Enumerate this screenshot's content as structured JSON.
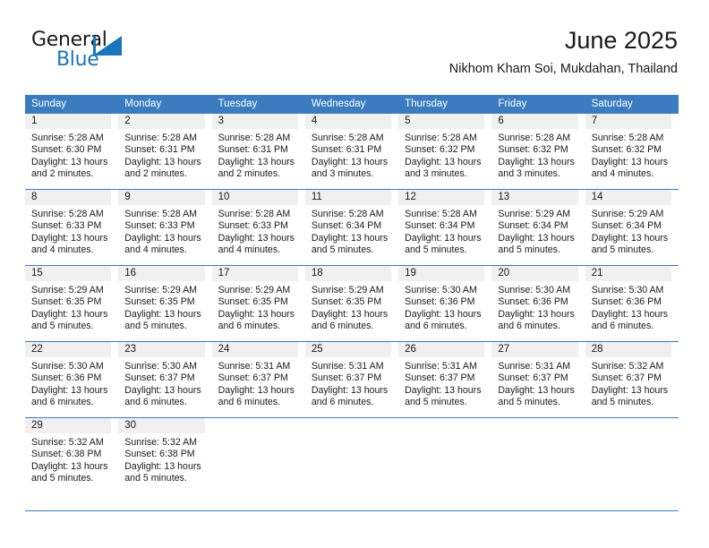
{
  "brand": {
    "name_part1": "General",
    "name_part2": "Blue",
    "accent_color": "#1b75bb"
  },
  "header": {
    "title": "June 2025",
    "subtitle": "Nikhom Kham Soi, Mukdahan, Thailand"
  },
  "theme": {
    "header_row_color": "#3b7cc0",
    "daynum_band_color": "#f0f0f0",
    "text_color": "#1a1a1a"
  },
  "calendar": {
    "weekday_headers": [
      "Sunday",
      "Monday",
      "Tuesday",
      "Wednesday",
      "Thursday",
      "Friday",
      "Saturday"
    ],
    "weeks": [
      [
        {
          "day": "1",
          "sunrise": "Sunrise: 5:28 AM",
          "sunset": "Sunset: 6:30 PM",
          "daylight_line1": "Daylight: 13 hours",
          "daylight_line2": "and 2 minutes."
        },
        {
          "day": "2",
          "sunrise": "Sunrise: 5:28 AM",
          "sunset": "Sunset: 6:31 PM",
          "daylight_line1": "Daylight: 13 hours",
          "daylight_line2": "and 2 minutes."
        },
        {
          "day": "3",
          "sunrise": "Sunrise: 5:28 AM",
          "sunset": "Sunset: 6:31 PM",
          "daylight_line1": "Daylight: 13 hours",
          "daylight_line2": "and 2 minutes."
        },
        {
          "day": "4",
          "sunrise": "Sunrise: 5:28 AM",
          "sunset": "Sunset: 6:31 PM",
          "daylight_line1": "Daylight: 13 hours",
          "daylight_line2": "and 3 minutes."
        },
        {
          "day": "5",
          "sunrise": "Sunrise: 5:28 AM",
          "sunset": "Sunset: 6:32 PM",
          "daylight_line1": "Daylight: 13 hours",
          "daylight_line2": "and 3 minutes."
        },
        {
          "day": "6",
          "sunrise": "Sunrise: 5:28 AM",
          "sunset": "Sunset: 6:32 PM",
          "daylight_line1": "Daylight: 13 hours",
          "daylight_line2": "and 3 minutes."
        },
        {
          "day": "7",
          "sunrise": "Sunrise: 5:28 AM",
          "sunset": "Sunset: 6:32 PM",
          "daylight_line1": "Daylight: 13 hours",
          "daylight_line2": "and 4 minutes."
        }
      ],
      [
        {
          "day": "8",
          "sunrise": "Sunrise: 5:28 AM",
          "sunset": "Sunset: 6:33 PM",
          "daylight_line1": "Daylight: 13 hours",
          "daylight_line2": "and 4 minutes."
        },
        {
          "day": "9",
          "sunrise": "Sunrise: 5:28 AM",
          "sunset": "Sunset: 6:33 PM",
          "daylight_line1": "Daylight: 13 hours",
          "daylight_line2": "and 4 minutes."
        },
        {
          "day": "10",
          "sunrise": "Sunrise: 5:28 AM",
          "sunset": "Sunset: 6:33 PM",
          "daylight_line1": "Daylight: 13 hours",
          "daylight_line2": "and 4 minutes."
        },
        {
          "day": "11",
          "sunrise": "Sunrise: 5:28 AM",
          "sunset": "Sunset: 6:34 PM",
          "daylight_line1": "Daylight: 13 hours",
          "daylight_line2": "and 5 minutes."
        },
        {
          "day": "12",
          "sunrise": "Sunrise: 5:28 AM",
          "sunset": "Sunset: 6:34 PM",
          "daylight_line1": "Daylight: 13 hours",
          "daylight_line2": "and 5 minutes."
        },
        {
          "day": "13",
          "sunrise": "Sunrise: 5:29 AM",
          "sunset": "Sunset: 6:34 PM",
          "daylight_line1": "Daylight: 13 hours",
          "daylight_line2": "and 5 minutes."
        },
        {
          "day": "14",
          "sunrise": "Sunrise: 5:29 AM",
          "sunset": "Sunset: 6:34 PM",
          "daylight_line1": "Daylight: 13 hours",
          "daylight_line2": "and 5 minutes."
        }
      ],
      [
        {
          "day": "15",
          "sunrise": "Sunrise: 5:29 AM",
          "sunset": "Sunset: 6:35 PM",
          "daylight_line1": "Daylight: 13 hours",
          "daylight_line2": "and 5 minutes."
        },
        {
          "day": "16",
          "sunrise": "Sunrise: 5:29 AM",
          "sunset": "Sunset: 6:35 PM",
          "daylight_line1": "Daylight: 13 hours",
          "daylight_line2": "and 5 minutes."
        },
        {
          "day": "17",
          "sunrise": "Sunrise: 5:29 AM",
          "sunset": "Sunset: 6:35 PM",
          "daylight_line1": "Daylight: 13 hours",
          "daylight_line2": "and 6 minutes."
        },
        {
          "day": "18",
          "sunrise": "Sunrise: 5:29 AM",
          "sunset": "Sunset: 6:35 PM",
          "daylight_line1": "Daylight: 13 hours",
          "daylight_line2": "and 6 minutes."
        },
        {
          "day": "19",
          "sunrise": "Sunrise: 5:30 AM",
          "sunset": "Sunset: 6:36 PM",
          "daylight_line1": "Daylight: 13 hours",
          "daylight_line2": "and 6 minutes."
        },
        {
          "day": "20",
          "sunrise": "Sunrise: 5:30 AM",
          "sunset": "Sunset: 6:36 PM",
          "daylight_line1": "Daylight: 13 hours",
          "daylight_line2": "and 6 minutes."
        },
        {
          "day": "21",
          "sunrise": "Sunrise: 5:30 AM",
          "sunset": "Sunset: 6:36 PM",
          "daylight_line1": "Daylight: 13 hours",
          "daylight_line2": "and 6 minutes."
        }
      ],
      [
        {
          "day": "22",
          "sunrise": "Sunrise: 5:30 AM",
          "sunset": "Sunset: 6:36 PM",
          "daylight_line1": "Daylight: 13 hours",
          "daylight_line2": "and 6 minutes."
        },
        {
          "day": "23",
          "sunrise": "Sunrise: 5:30 AM",
          "sunset": "Sunset: 6:37 PM",
          "daylight_line1": "Daylight: 13 hours",
          "daylight_line2": "and 6 minutes."
        },
        {
          "day": "24",
          "sunrise": "Sunrise: 5:31 AM",
          "sunset": "Sunset: 6:37 PM",
          "daylight_line1": "Daylight: 13 hours",
          "daylight_line2": "and 6 minutes."
        },
        {
          "day": "25",
          "sunrise": "Sunrise: 5:31 AM",
          "sunset": "Sunset: 6:37 PM",
          "daylight_line1": "Daylight: 13 hours",
          "daylight_line2": "and 6 minutes."
        },
        {
          "day": "26",
          "sunrise": "Sunrise: 5:31 AM",
          "sunset": "Sunset: 6:37 PM",
          "daylight_line1": "Daylight: 13 hours",
          "daylight_line2": "and 5 minutes."
        },
        {
          "day": "27",
          "sunrise": "Sunrise: 5:31 AM",
          "sunset": "Sunset: 6:37 PM",
          "daylight_line1": "Daylight: 13 hours",
          "daylight_line2": "and 5 minutes."
        },
        {
          "day": "28",
          "sunrise": "Sunrise: 5:32 AM",
          "sunset": "Sunset: 6:37 PM",
          "daylight_line1": "Daylight: 13 hours",
          "daylight_line2": "and 5 minutes."
        }
      ],
      [
        {
          "day": "29",
          "sunrise": "Sunrise: 5:32 AM",
          "sunset": "Sunset: 6:38 PM",
          "daylight_line1": "Daylight: 13 hours",
          "daylight_line2": "and 5 minutes."
        },
        {
          "day": "30",
          "sunrise": "Sunrise: 5:32 AM",
          "sunset": "Sunset: 6:38 PM",
          "daylight_line1": "Daylight: 13 hours",
          "daylight_line2": "and 5 minutes."
        },
        {
          "day": "",
          "sunrise": "",
          "sunset": "",
          "daylight_line1": "",
          "daylight_line2": ""
        },
        {
          "day": "",
          "sunrise": "",
          "sunset": "",
          "daylight_line1": "",
          "daylight_line2": ""
        },
        {
          "day": "",
          "sunrise": "",
          "sunset": "",
          "daylight_line1": "",
          "daylight_line2": ""
        },
        {
          "day": "",
          "sunrise": "",
          "sunset": "",
          "daylight_line1": "",
          "daylight_line2": ""
        },
        {
          "day": "",
          "sunrise": "",
          "sunset": "",
          "daylight_line1": "",
          "daylight_line2": ""
        }
      ]
    ]
  }
}
